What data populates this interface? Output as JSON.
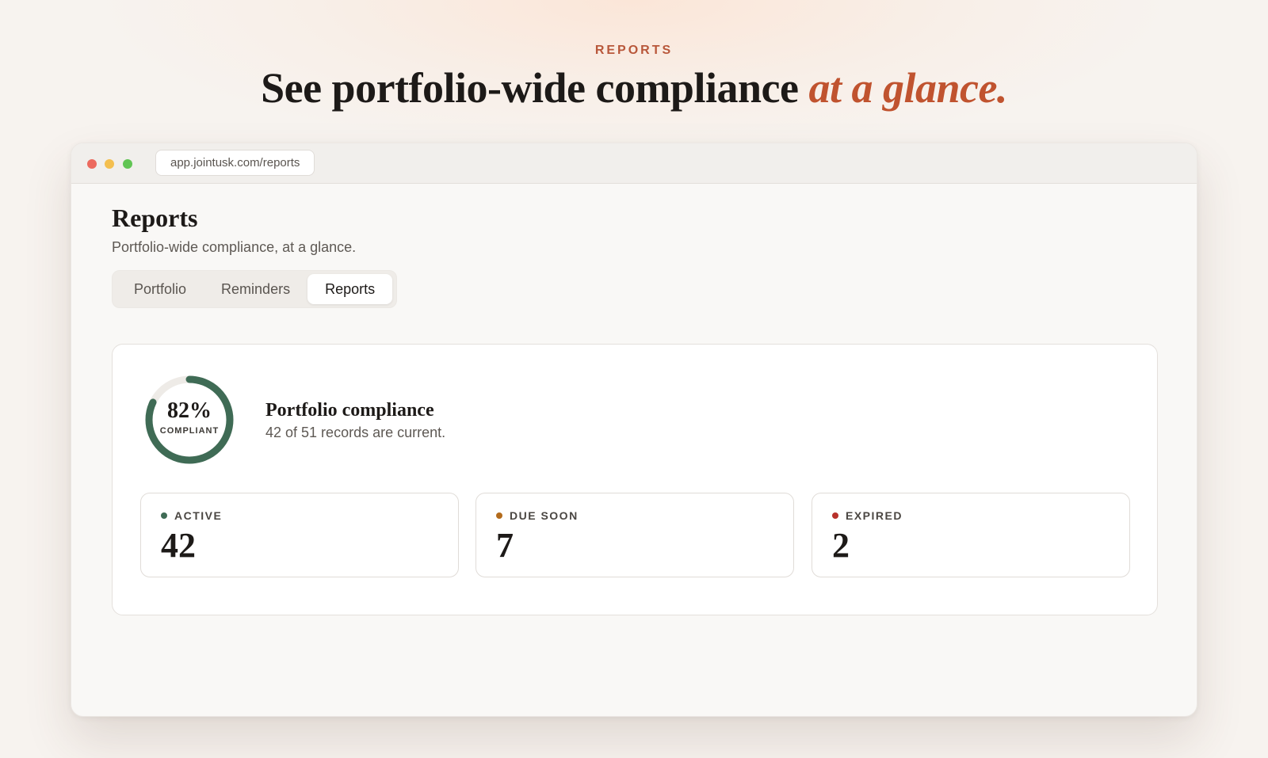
{
  "hero": {
    "eyebrow": "REPORTS",
    "headline_main": "See portfolio-wide compliance ",
    "headline_accent": "at a glance."
  },
  "browser": {
    "url": "app.jointusk.com/reports"
  },
  "page": {
    "title": "Reports",
    "subtitle": "Portfolio-wide compliance, at a glance."
  },
  "tabs": [
    {
      "label": "Portfolio",
      "active": false
    },
    {
      "label": "Reminders",
      "active": false
    },
    {
      "label": "Reports",
      "active": true
    }
  ],
  "compliance": {
    "percent": 82,
    "percent_label": "82%",
    "ring_label": "COMPLIANT",
    "title": "Portfolio compliance",
    "subtitle": "42 of 51 records are current."
  },
  "stats": [
    {
      "label": "ACTIVE",
      "value": "42",
      "color": "#3f6b55"
    },
    {
      "label": "DUE SOON",
      "value": "7",
      "color": "#b36b1c"
    },
    {
      "label": "EXPIRED",
      "value": "2",
      "color": "#b8312b"
    }
  ],
  "colors": {
    "accent": "#c0532f",
    "ring": "#3f6b55",
    "ring_track": "#eeebe7"
  }
}
